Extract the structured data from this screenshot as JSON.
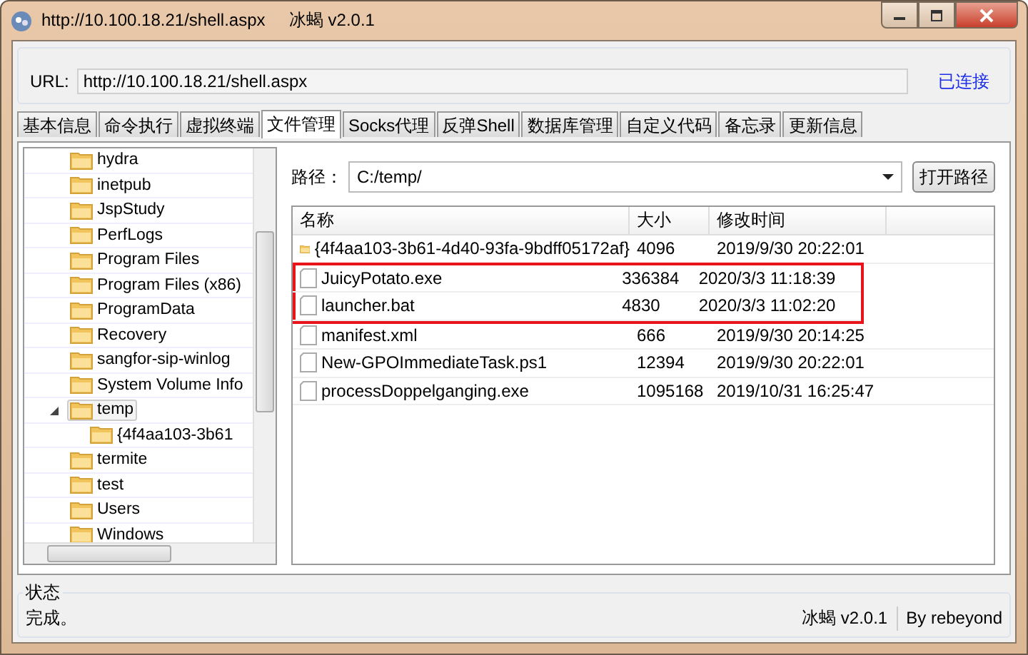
{
  "window": {
    "title": "http://10.100.18.21/shell.aspx     冰蝎 v2.0.1"
  },
  "url_bar": {
    "label": "URL:",
    "value": "http://10.100.18.21/shell.aspx",
    "status": "已连接"
  },
  "tabs": [
    {
      "label": "基本信息",
      "selected": false
    },
    {
      "label": "命令执行",
      "selected": false
    },
    {
      "label": "虚拟终端",
      "selected": false
    },
    {
      "label": "文件管理",
      "selected": true
    },
    {
      "label": "Socks代理",
      "selected": false
    },
    {
      "label": "反弹Shell",
      "selected": false
    },
    {
      "label": "数据库管理",
      "selected": false
    },
    {
      "label": "自定义代码",
      "selected": false
    },
    {
      "label": "备忘录",
      "selected": false
    },
    {
      "label": "更新信息",
      "selected": false
    }
  ],
  "tree": {
    "items": [
      {
        "label": "hydra",
        "selected": false
      },
      {
        "label": "inetpub",
        "selected": false
      },
      {
        "label": "JspStudy",
        "selected": false
      },
      {
        "label": "PerfLogs",
        "selected": false
      },
      {
        "label": "Program Files",
        "selected": false
      },
      {
        "label": "Program Files (x86)",
        "selected": false
      },
      {
        "label": "ProgramData",
        "selected": false
      },
      {
        "label": "Recovery",
        "selected": false
      },
      {
        "label": "sangfor-sip-winlog",
        "selected": false
      },
      {
        "label": "System Volume Info",
        "selected": false
      },
      {
        "label": "temp",
        "selected": true,
        "expanded": true,
        "children": [
          {
            "label": "{4f4aa103-3b61",
            "selected": false
          }
        ]
      },
      {
        "label": "termite",
        "selected": false
      },
      {
        "label": "test",
        "selected": false
      },
      {
        "label": "Users",
        "selected": false
      },
      {
        "label": "Windows",
        "selected": false
      }
    ]
  },
  "path_bar": {
    "label": "路径：",
    "value": "C:/temp/",
    "button": "打开路径"
  },
  "file_list": {
    "columns": [
      "名称",
      "大小",
      "修改时间"
    ],
    "rows": [
      {
        "kind": "folder",
        "name": "{4f4aa103-3b61-4d40-93fa-9bdff05172af}",
        "size": "4096",
        "modified": "2019/9/30 20:22:01",
        "highlighted": false
      },
      {
        "kind": "file",
        "name": "JuicyPotato.exe",
        "size": "336384",
        "modified": "2020/3/3 11:18:39",
        "highlighted": true
      },
      {
        "kind": "file",
        "name": "launcher.bat",
        "size": "4830",
        "modified": "2020/3/3 11:02:20",
        "highlighted": true
      },
      {
        "kind": "file",
        "name": "manifest.xml",
        "size": "666",
        "modified": "2019/9/30 20:14:25",
        "highlighted": false
      },
      {
        "kind": "file",
        "name": "New-GPOImmediateTask.ps1",
        "size": "12394",
        "modified": "2019/9/30 20:22:01",
        "highlighted": false
      },
      {
        "kind": "file",
        "name": "processDoppelganging.exe",
        "size": "1095168",
        "modified": "2019/10/31 16:25:47",
        "highlighted": false
      }
    ]
  },
  "status_bar": {
    "group_label": "状态",
    "message": "完成。",
    "version": "冰蝎 v2.0.1",
    "author": "By rebeyond"
  }
}
